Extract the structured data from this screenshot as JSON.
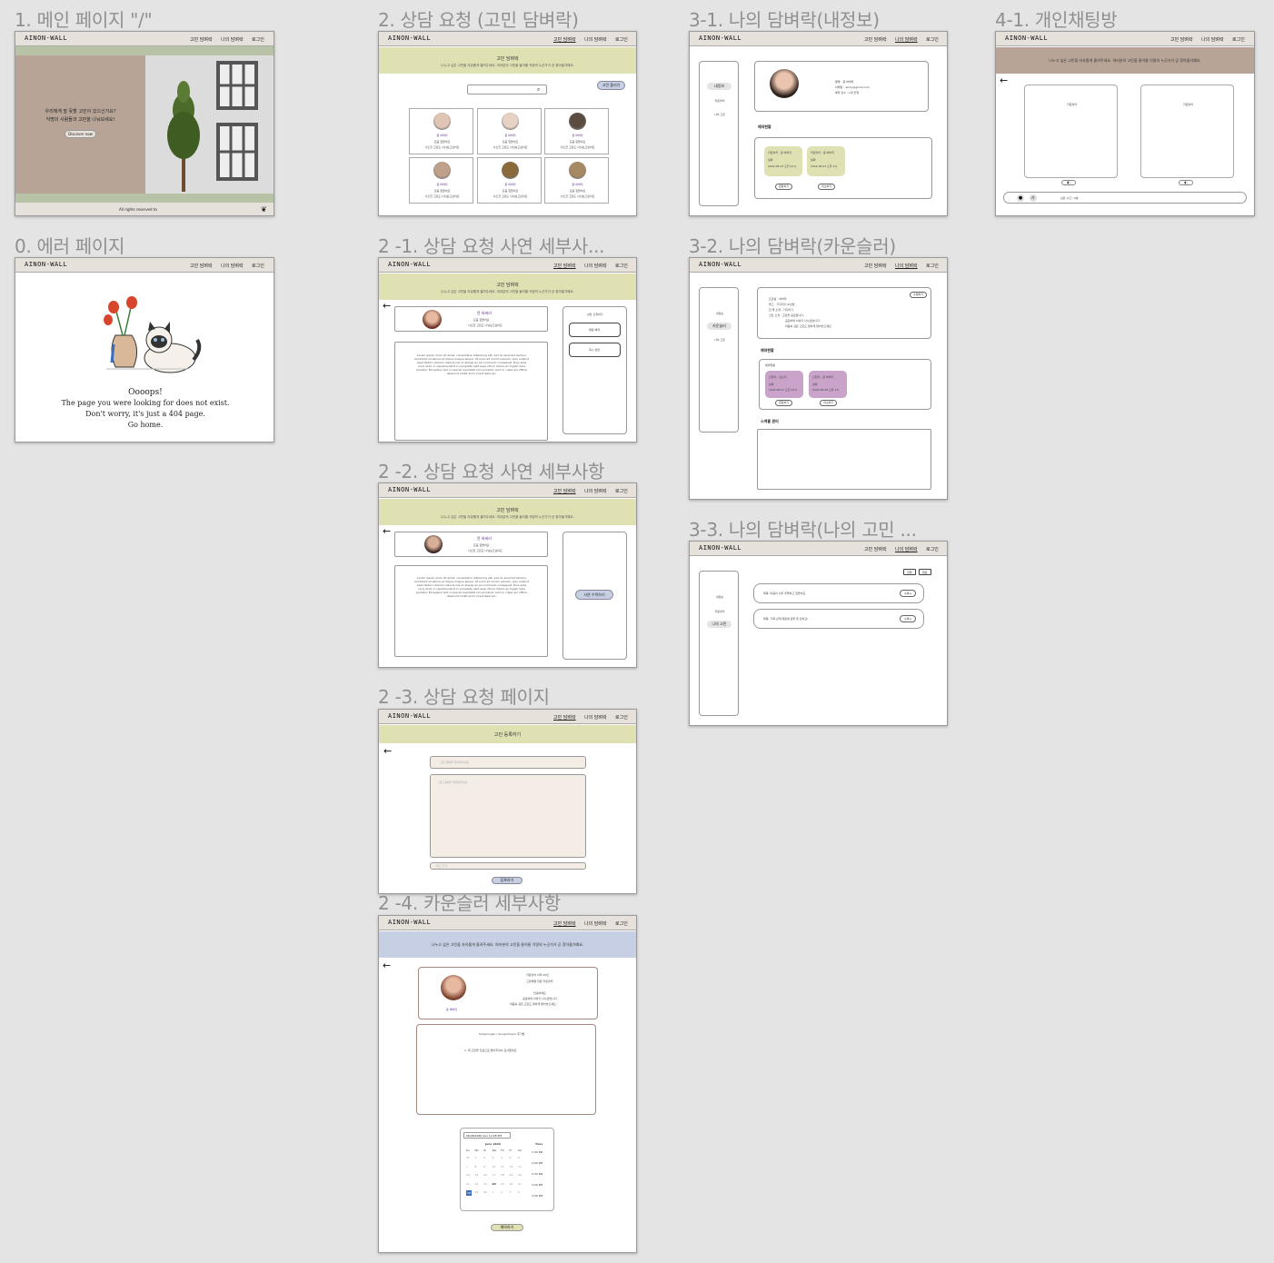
{
  "nav": {
    "logo": "AINON-WALL",
    "links": [
      "고민 담벼락",
      "나의 담벼락",
      "로그인"
    ]
  },
  "titles": {
    "main": "1. 메인 페이지 \"/\"",
    "error": "0. 에러 페이지",
    "counsel": "2. 상담 요청 (고민  담벼락)",
    "detail1": "2 -1. 상담 요청 사연 세부사...",
    "detail2": "2 -2. 상담 요청 사연 세부사항",
    "request": "2 -3. 상담 요청 페이지",
    "counselor": "2 -4. 카운슬러 세부사항",
    "myinfo": "3-1.  나의 담벼락(내정보)",
    "mycounselor": "3-2. 나의 담벼락(카운슬러)",
    "myworries": "3-3. 나의 담벼락(나의 고민 ...",
    "chat": "4-1. 개인채팅방"
  },
  "main_page": {
    "hero_line1": "우리에게 말 못할 고민이 있으신가요?",
    "hero_line2": "익명의 사람들과 고민을 나눠보세요!",
    "discover": "Discover now",
    "footer": "All rights reserved to"
  },
  "error_page": {
    "line1": "Oooops!",
    "line2": "The page you were looking for does not exist.",
    "line3": "Don't worry, it's just a 404 page.",
    "line4": "Go home."
  },
  "wall": {
    "title": "고민 담벼락",
    "subtitle": "나누고 싶은 고민을 자유롭게 올려주세요. 여러분의 고민을 들어줄 익명의 누군가가 곧 찾아올거예요.",
    "post_button": "고민 올리기",
    "cards": [
      {
        "name": "뮨 바버리",
        "l1": "요즘 힘들어요",
        "l2": "사소한 고민도 나눠보고싶어요"
      },
      {
        "name": "뮨 바버리",
        "l1": "요즘 힘들어요",
        "l2": "사소한 고민도 나눠보고싶어요"
      },
      {
        "name": "뮨 바버리",
        "l1": "요즘 힘들어요",
        "l2": "사소한 고민도 나눠보고싶어요"
      },
      {
        "name": "뮨 바버리",
        "l1": "요즘 힘들어요",
        "l2": "사소한 고민도 나눠보고싶어요"
      },
      {
        "name": "뮨 바버리",
        "l1": "요즘 힘들어요",
        "l2": "사소한 고민도 나눠보고싶어요"
      },
      {
        "name": "뮨 바버리",
        "l1": "요즘 힘들어요",
        "l2": "사소한 고민도 나눠보고싶어요"
      }
    ]
  },
  "detail": {
    "name": "뮨 바버리",
    "l1": "요즘 힘들어요",
    "l2": "사소한 고민도 나눠보고싶어요",
    "side_title": "상담 신청하기",
    "btn_a": "채팅 예약",
    "btn_b": "즉시 상담",
    "accept": "사연 수락하기",
    "lorem": "Lorem ipsum dolor sit amet, consectetur adipiscing elit, sed do eiusmod tempor incididunt ut labore et dolore magna aliqua. Ut enim ad minim veniam, quis nostrud exercitation ullamco laboris nisi ut aliquip ex ea commodo consequat. Duis aute irure dolor in reprehenderit in voluptate velit esse cillum dolore eu fugiat nulla pariatur. Excepteur sint occaecat cupidatat non proident, sunt in culpa qui officia deserunt mollit anim id est laborum."
  },
  "request": {
    "bar": "고민 등록하기",
    "title_ph": "고민 제목을 입력해주세요.",
    "content_ph": "고민 내용을 입력해주세요.",
    "tag_ph": "태그 추가",
    "submit": "등록하기"
  },
  "counselor": {
    "bar": "나누고 싶은 고민을 자유롭게 올려주세요. 여러분의 고민을 들어줄 익명의 누군가가 곧 찾아올거예요.",
    "header": "카운슬러 이력 20년",
    "sub": "고민해결 전문 카운슬러",
    "name": "뮨 바버리",
    "intro1": "안녕하세요.",
    "intro2": "공감하며 이야기 나누겠습니다.",
    "intro3": "마음속 깊은 고민도 편하게 털어놓으세요.",
    "reviews": "Simyoungsu / Songmimyim 후기방",
    "review1": "1. 제 고민을 진심으로 들어주셔서 감사했어요.",
    "date_field": "06/28/2020 Sun 12:26 PM",
    "month": "June 2020",
    "time_label": "Time",
    "days": [
      "Su",
      "Mo",
      "Tu",
      "We",
      "Th",
      "Fr",
      "Sa"
    ],
    "weeks": [
      [
        "31",
        "1",
        "2",
        "3",
        "4",
        "5",
        "6"
      ],
      [
        "7",
        "8",
        "9",
        "10",
        "11",
        "12",
        "13"
      ],
      [
        "14",
        "15",
        "16",
        "17",
        "18",
        "19",
        "20"
      ],
      [
        "21",
        "22",
        "23",
        "24",
        "25",
        "26",
        "27"
      ],
      [
        "28",
        "29",
        "30",
        "1",
        "2",
        "3",
        "4"
      ]
    ],
    "times": [
      "1:30 PM",
      "2:00 PM",
      "2:30 PM",
      "3:00 PM",
      "3:30 PM"
    ],
    "reserve": "예약하기"
  },
  "myinfo": {
    "menu": [
      "내정보",
      "카운슬러",
      "나의 고민"
    ],
    "nick": "별명 : 뮨 바버리",
    "email": "이메일 : asmy@gmail.com",
    "count": "예약 횟수 : 1회 진행",
    "reserve_title": "예약현황",
    "r1a": "카운슬러 : 뮨 바버리",
    "r1b": "날짜",
    "r1c": "2022.08.23 오전 10시",
    "r2a": "카운슬러 : 뮨 바버리",
    "r2b": "날짜",
    "r2c": "2022.08.23 오후 2시",
    "enter": "입장하기",
    "cancel": "취소하기"
  },
  "mycounselor": {
    "menu": [
      "내정보",
      "카운슬러",
      "나의 고민"
    ],
    "edit": "수정하기",
    "i1": "프로필 : 바버리",
    "i2": "태그 : 기다리기 #상담",
    "i3": "한 줄 소개 : 기다리기",
    "i4": "간단 소개 : 고민을 공감합니다.",
    "i5": "공감하며 이야기 나누겠습니다.",
    "i6": "마음속 깊은 고민도 편하게 털어놓으세요.",
    "status": "예약현황",
    "inner": "예약현황",
    "a1": "신청자 : 김소리",
    "a2": "날짜",
    "a3": "2022.08.27 오전 10시",
    "b1": "신청자 : 뮨 바버리",
    "b2": "날짜",
    "b3": "2022.08.28 오후 2시",
    "enter": "입장하기",
    "cancel": "취소하기",
    "schedule": "스케줄 관리"
  },
  "myworries": {
    "menu": [
      "내정보",
      "카운슬러",
      "나의 고민"
    ],
    "btn1": "진행",
    "btn2": "완료",
    "q1": "제목: 마음이 너무 우울하고 힘들어요",
    "q2": "제목: 가족 관계 때문에 잠을 못 잤어요!",
    "status": "수락 ▸"
  },
  "chat": {
    "bar": "나누고 싶은 고민을 자유롭게 올려주세요. 여러분의 고민을 들어줄 익명의 누군가가 곧 찾아올거예요.",
    "p1": "카운슬러",
    "p2": "카운슬러",
    "time": "남은 시간 : 5분"
  }
}
